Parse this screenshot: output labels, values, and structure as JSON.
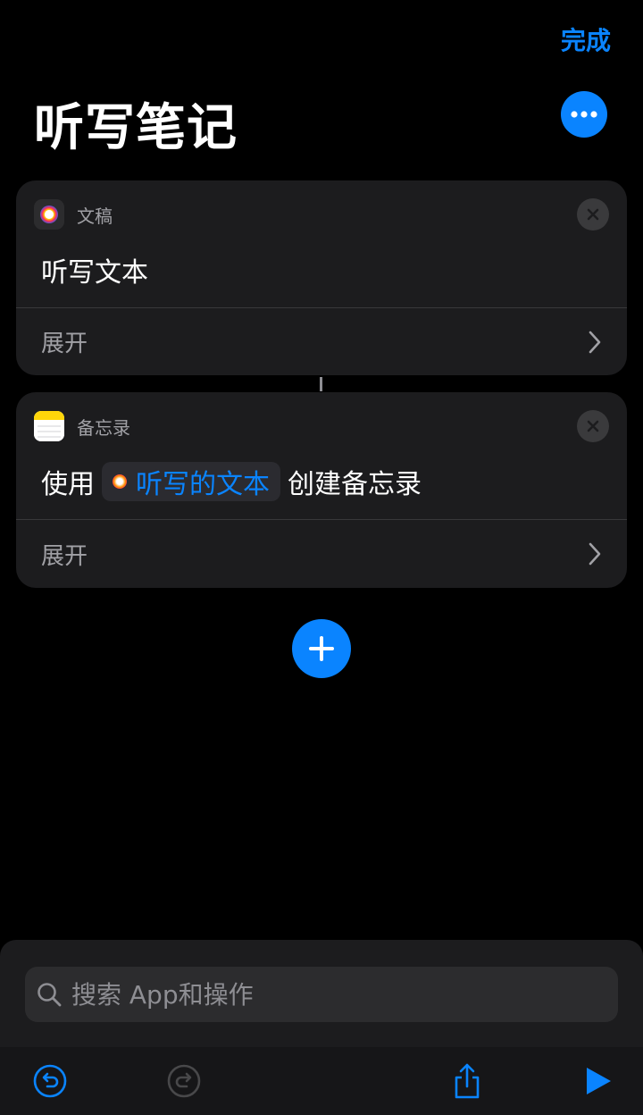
{
  "header": {
    "done_label": "完成",
    "title": "听写笔记"
  },
  "actions": [
    {
      "app_name": "文稿",
      "text": "听写文本",
      "expand_label": "展开"
    },
    {
      "app_name": "备忘录",
      "prefix": "使用",
      "variable": "听写的文本",
      "suffix": "创建备忘录",
      "expand_label": "展开"
    }
  ],
  "search": {
    "placeholder": "搜索 App和操作"
  },
  "colors": {
    "accent": "#0a84ff",
    "card": "#1c1c1e",
    "background": "#000000"
  }
}
